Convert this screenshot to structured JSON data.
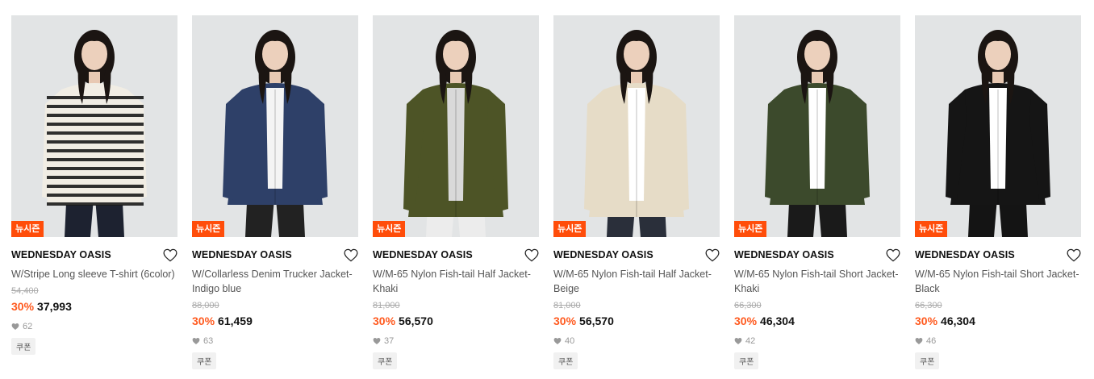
{
  "colors": {
    "badge": "#ff4d0a",
    "discount": "#ff5a1f"
  },
  "products": [
    {
      "badge": "뉴시즌",
      "brand": "WEDNESDAY OASIS",
      "name": "W/Stripe Long sleeve T-shirt (6color)",
      "original_price": "54,400",
      "discount": "30%",
      "price": "37,993",
      "likes": "62",
      "coupon": "쿠폰",
      "garment": "stripe"
    },
    {
      "badge": "뉴시즌",
      "brand": "WEDNESDAY OASIS",
      "name": "W/Collarless Denim Trucker Jacket-Indigo blue",
      "original_price": "88,000",
      "discount": "30%",
      "price": "61,459",
      "likes": "63",
      "coupon": "쿠폰",
      "garment": "denim"
    },
    {
      "badge": "뉴시즌",
      "brand": "WEDNESDAY OASIS",
      "name": "W/M-65 Nylon Fish-tail Half Jacket-Khaki",
      "original_price": "81,000",
      "discount": "30%",
      "price": "56,570",
      "likes": "37",
      "coupon": "쿠폰",
      "garment": "khaki-long"
    },
    {
      "badge": "뉴시즌",
      "brand": "WEDNESDAY OASIS",
      "name": "W/M-65 Nylon Fish-tail Half Jacket-Beige",
      "original_price": "81,000",
      "discount": "30%",
      "price": "56,570",
      "likes": "40",
      "coupon": "쿠폰",
      "garment": "beige-long"
    },
    {
      "badge": "뉴시즌",
      "brand": "WEDNESDAY OASIS",
      "name": "W/M-65 Nylon Fish-tail Short Jacket-Khaki",
      "original_price": "66,300",
      "discount": "30%",
      "price": "46,304",
      "likes": "42",
      "coupon": "쿠폰",
      "garment": "khaki-short"
    },
    {
      "badge": "뉴시즌",
      "brand": "WEDNESDAY OASIS",
      "name": "W/M-65 Nylon Fish-tail Short Jacket-Black",
      "original_price": "66,300",
      "discount": "30%",
      "price": "46,304",
      "likes": "46",
      "coupon": "쿠폰",
      "garment": "black-short"
    }
  ]
}
